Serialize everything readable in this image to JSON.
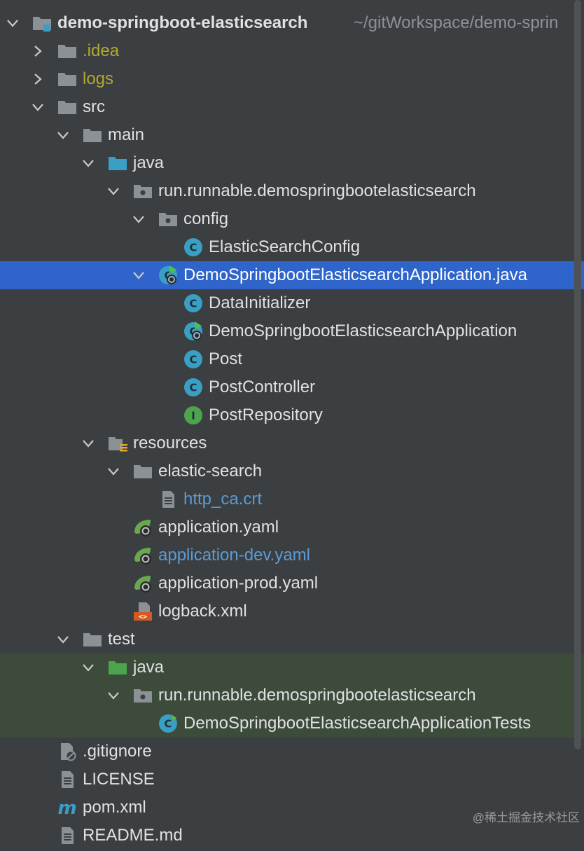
{
  "colors": {
    "background": "#3c3f41",
    "selection": "#2f65ca",
    "test_highlight": "#3d4b3a",
    "folder": "#8c9195",
    "source_folder": "#3a9fc4",
    "test_folder": "#4ca54c",
    "class_icon": "#3a9fc4",
    "interface_icon": "#4ca54c",
    "spring_leaf": "#6aa84f",
    "excluded_text": "#b4a82a",
    "modified_text": "#5b9bd5"
  },
  "tree": [
    {
      "label": "demo-springboot-elasticsearch",
      "suffix": "~/gitWorkspace/demo-sprin",
      "depth": 0,
      "expanded": true,
      "icon": "module-folder-icon"
    },
    {
      "label": ".idea",
      "depth": 1,
      "expanded": false,
      "icon": "folder-icon",
      "style": "excluded"
    },
    {
      "label": "logs",
      "depth": 1,
      "expanded": false,
      "icon": "folder-icon",
      "style": "excluded"
    },
    {
      "label": "src",
      "depth": 1,
      "expanded": true,
      "icon": "folder-icon"
    },
    {
      "label": "main",
      "depth": 2,
      "expanded": true,
      "icon": "folder-icon"
    },
    {
      "label": "java",
      "depth": 3,
      "expanded": true,
      "icon": "source-folder-icon"
    },
    {
      "label": "run.runnable.demospringbootelasticsearch",
      "depth": 4,
      "expanded": true,
      "icon": "package-icon"
    },
    {
      "label": "config",
      "depth": 5,
      "expanded": true,
      "icon": "package-icon"
    },
    {
      "label": "ElasticSearchConfig",
      "depth": 6,
      "icon": "class-icon"
    },
    {
      "label": "DemoSpringbootElasticsearchApplication.java",
      "depth": 5,
      "expanded": true,
      "icon": "spring-boot-class-icon",
      "selected": true
    },
    {
      "label": "DataInitializer",
      "depth": 6,
      "icon": "class-icon"
    },
    {
      "label": "DemoSpringbootElasticsearchApplication",
      "depth": 6,
      "icon": "spring-boot-class-icon"
    },
    {
      "label": "Post",
      "depth": 6,
      "icon": "class-icon"
    },
    {
      "label": "PostController",
      "depth": 6,
      "icon": "class-icon"
    },
    {
      "label": "PostRepository",
      "depth": 6,
      "icon": "interface-icon"
    },
    {
      "label": "resources",
      "depth": 3,
      "expanded": true,
      "icon": "resources-folder-icon"
    },
    {
      "label": "elastic-search",
      "depth": 4,
      "expanded": true,
      "icon": "folder-icon"
    },
    {
      "label": "http_ca.crt",
      "depth": 5,
      "icon": "file-icon",
      "style": "modified"
    },
    {
      "label": "application.yaml",
      "depth": 4,
      "icon": "spring-config-icon"
    },
    {
      "label": "application-dev.yaml",
      "depth": 4,
      "icon": "spring-config-icon",
      "style": "modified"
    },
    {
      "label": "application-prod.yaml",
      "depth": 4,
      "icon": "spring-config-icon"
    },
    {
      "label": "logback.xml",
      "depth": 4,
      "icon": "xml-file-icon"
    },
    {
      "label": "test",
      "depth": 2,
      "expanded": true,
      "icon": "folder-icon"
    },
    {
      "label": "java",
      "depth": 3,
      "expanded": true,
      "icon": "test-folder-icon",
      "highlight": true
    },
    {
      "label": "run.runnable.demospringbootelasticsearch",
      "depth": 4,
      "expanded": true,
      "icon": "package-icon",
      "highlight": true
    },
    {
      "label": "DemoSpringbootElasticsearchApplicationTests",
      "depth": 5,
      "icon": "test-class-icon",
      "highlight": true
    },
    {
      "label": ".gitignore",
      "depth": 1,
      "icon": "gitignore-icon"
    },
    {
      "label": "LICENSE",
      "depth": 1,
      "icon": "text-file-icon"
    },
    {
      "label": "pom.xml",
      "depth": 1,
      "icon": "maven-icon"
    },
    {
      "label": "README.md",
      "depth": 1,
      "icon": "text-file-icon"
    }
  ],
  "watermark": "@稀土掘金技术社区"
}
